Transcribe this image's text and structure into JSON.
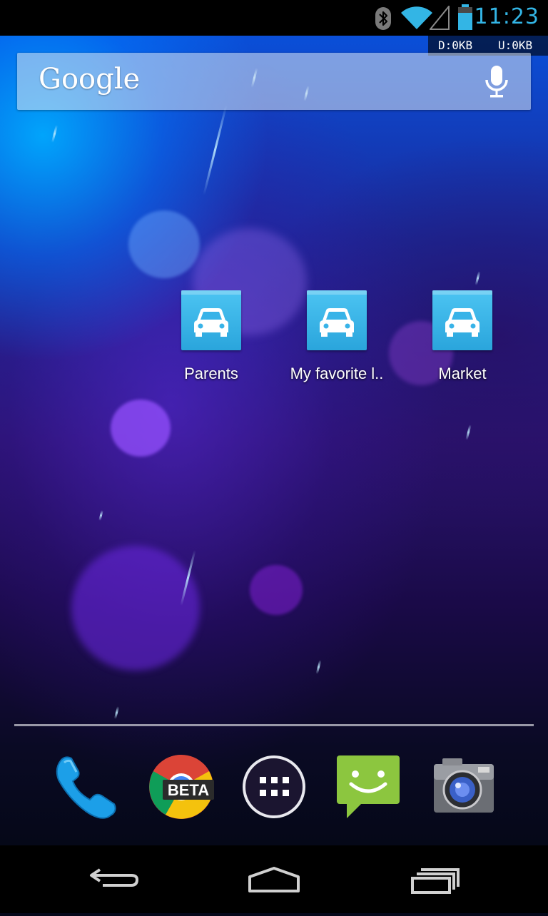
{
  "status_bar": {
    "time": "11:23",
    "icons": [
      "bluetooth-icon",
      "wifi-icon",
      "signal-icon",
      "battery-icon"
    ],
    "accent_color": "#33b5e5"
  },
  "net_meter": {
    "download": "D:0KB",
    "upload": "U:0KB"
  },
  "search": {
    "logo_text": "Google",
    "mic_icon": "microphone-icon"
  },
  "shortcuts": [
    {
      "label": "Parents",
      "icon": "car-icon"
    },
    {
      "label": "My favorite l..",
      "icon": "car-icon"
    },
    {
      "label": "Market",
      "icon": "car-icon"
    }
  ],
  "dock": {
    "items": [
      {
        "name": "phone",
        "icon": "phone-icon"
      },
      {
        "name": "chrome-beta",
        "icon": "chrome-icon",
        "badge": "BETA"
      },
      {
        "name": "app-drawer",
        "icon": "app-drawer-icon"
      },
      {
        "name": "messaging",
        "icon": "messaging-icon"
      },
      {
        "name": "camera",
        "icon": "camera-icon"
      }
    ]
  },
  "nav_bar": {
    "buttons": [
      "back-icon",
      "home-icon",
      "recent-apps-icon"
    ]
  }
}
